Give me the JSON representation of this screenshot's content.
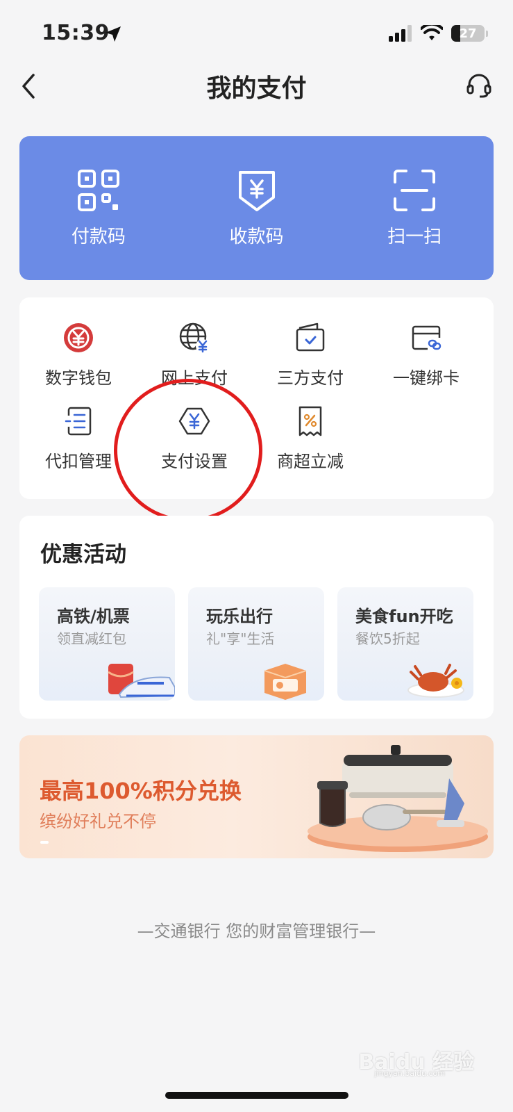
{
  "status_bar": {
    "time": "15:39",
    "battery_level": "27",
    "battery_fraction": 0.27
  },
  "nav": {
    "title": "我的支付",
    "back_icon": "chevron-left-icon",
    "support_icon": "headset-icon"
  },
  "quick_actions": [
    {
      "label": "付款码",
      "icon": "qr-code-icon"
    },
    {
      "label": "收款码",
      "icon": "yuan-receive-icon"
    },
    {
      "label": "扫一扫",
      "icon": "scan-icon"
    }
  ],
  "services": [
    {
      "label": "数字钱包",
      "icon": "digital-yuan-icon"
    },
    {
      "label": "网上支付",
      "icon": "globe-yuan-icon"
    },
    {
      "label": "三方支付",
      "icon": "wallet-check-icon"
    },
    {
      "label": "一键绑卡",
      "icon": "card-link-icon"
    },
    {
      "label": "代扣管理",
      "icon": "list-doc-icon"
    },
    {
      "label": "支付设置",
      "icon": "hexagon-yuan-icon"
    },
    {
      "label": "商超立减",
      "icon": "receipt-percent-icon"
    }
  ],
  "promotions": {
    "title": "优惠活动",
    "items": [
      {
        "title": "高铁/机票",
        "subtitle": "领直减红包"
      },
      {
        "title": "玩乐出行",
        "subtitle": "礼\"享\"生活"
      },
      {
        "title": "美食fun开吃",
        "subtitle": "餐饮5折起"
      }
    ]
  },
  "banner": {
    "title": "最高100%积分兑换",
    "subtitle": "缤纷好礼兑不停"
  },
  "footer": {
    "slogan": "—交通银行 您的财富管理银行—"
  },
  "watermark": {
    "brand": "Baidu 经验",
    "url": "jingyan.baidu.com"
  },
  "colors": {
    "primary_card": "#6b8be6",
    "accent_blue": "#3a66d6",
    "digital_yuan_red": "#d43b3b",
    "banner_text": "#dd5a2f",
    "annotation_circle": "#e11d1d"
  }
}
